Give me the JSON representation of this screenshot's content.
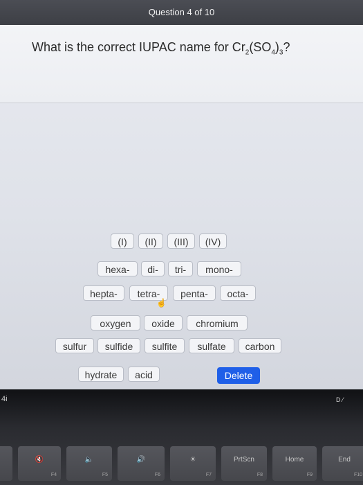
{
  "header": {
    "counter": "Question 4 of 10"
  },
  "question": {
    "prefix": "What is the correct IUPAC name for Cr",
    "sub1": "2",
    "mid": "(SO",
    "sub2": "4",
    "close": ")",
    "sub3": "3",
    "end": "?"
  },
  "tiles": {
    "roman": [
      "(I)",
      "(II)",
      "(III)",
      "(IV)"
    ],
    "prefixes_row1": [
      "hexa-",
      "di-",
      "tri-",
      "mono-"
    ],
    "prefixes_row2": [
      "hepta-",
      "tetra-",
      "penta-",
      "octa-"
    ],
    "words_row1": [
      "oxygen",
      "oxide",
      "chromium"
    ],
    "words_row2": [
      "sulfur",
      "sulfide",
      "sulfite",
      "sulfate",
      "carbon"
    ],
    "words_row3": [
      "hydrate",
      "acid"
    ]
  },
  "delete_label": "Delete",
  "bezel": {
    "left_mark": "4i",
    "right_mark": "D ⁄"
  },
  "keyboard": [
    {
      "main": "🔇",
      "fn": "F4"
    },
    {
      "main": "🔈",
      "fn": "F5"
    },
    {
      "main": "🔊",
      "fn": "F6"
    },
    {
      "main": "☀",
      "fn": "F7"
    },
    {
      "main": "PrtScn",
      "fn": "F8"
    },
    {
      "main": "Home",
      "fn": "F9"
    },
    {
      "main": "End",
      "fn": "F10"
    }
  ]
}
